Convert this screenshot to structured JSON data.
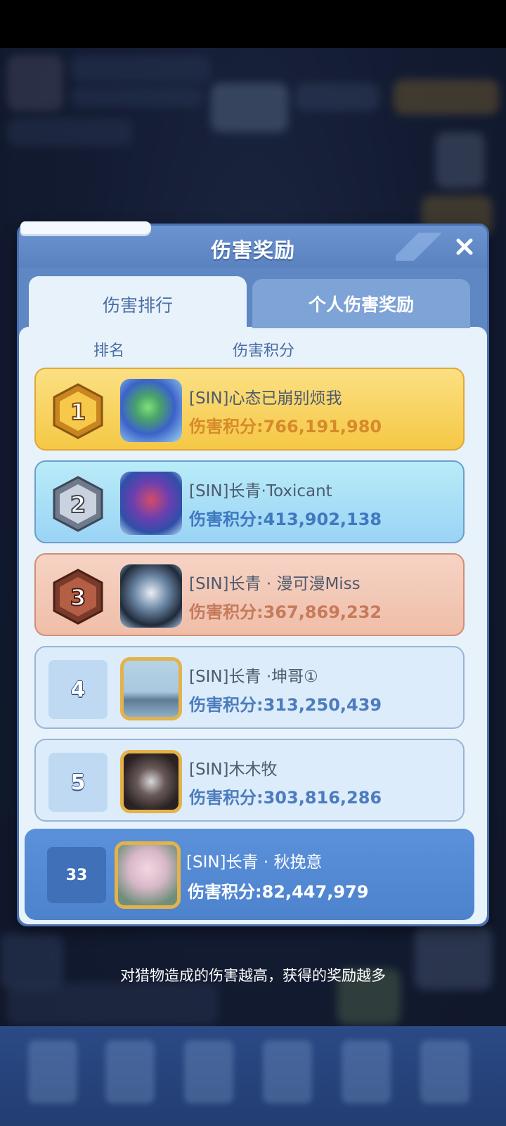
{
  "dialog": {
    "title": "伤害奖励",
    "tabs": [
      {
        "label": "伤害排行",
        "active": true
      },
      {
        "label": "个人伤害奖励",
        "active": false
      }
    ],
    "columns": {
      "rank": "排名",
      "score": "伤害积分"
    }
  },
  "rows": [
    {
      "rank": "1",
      "name": "[SIN]心态已崩别烦我",
      "score": "伤害积分:766,191,980"
    },
    {
      "rank": "2",
      "name": "[SIN]长青·Toxicant",
      "score": "伤害积分:413,902,138"
    },
    {
      "rank": "3",
      "name": "[SIN]长青 · 漫可漫Miss",
      "score": "伤害积分:367,869,232"
    },
    {
      "rank": "4",
      "name": "[SIN]长青 ·坤哥①",
      "score": "伤害积分:313,250,439"
    },
    {
      "rank": "5",
      "name": "[SIN]木木牧",
      "score": "伤害积分:303,816,286"
    }
  ],
  "self_row": {
    "rank": "33",
    "name": "[SIN]长青 · 秋挽意",
    "score": "伤害积分:82,447,979"
  },
  "footer": "对猎物造成的伤害越高，获得的奖励越多",
  "colors": {
    "dialog_blue": "#5f87c4",
    "gold": "#f5c845",
    "silver": "#9ad3f5",
    "bronze": "#efbea9",
    "self_highlight": "#4d82cd"
  },
  "icons": {
    "close": "close-icon",
    "rank1": "gold-medal-icon",
    "rank2": "silver-medal-icon",
    "rank3": "bronze-medal-icon"
  }
}
